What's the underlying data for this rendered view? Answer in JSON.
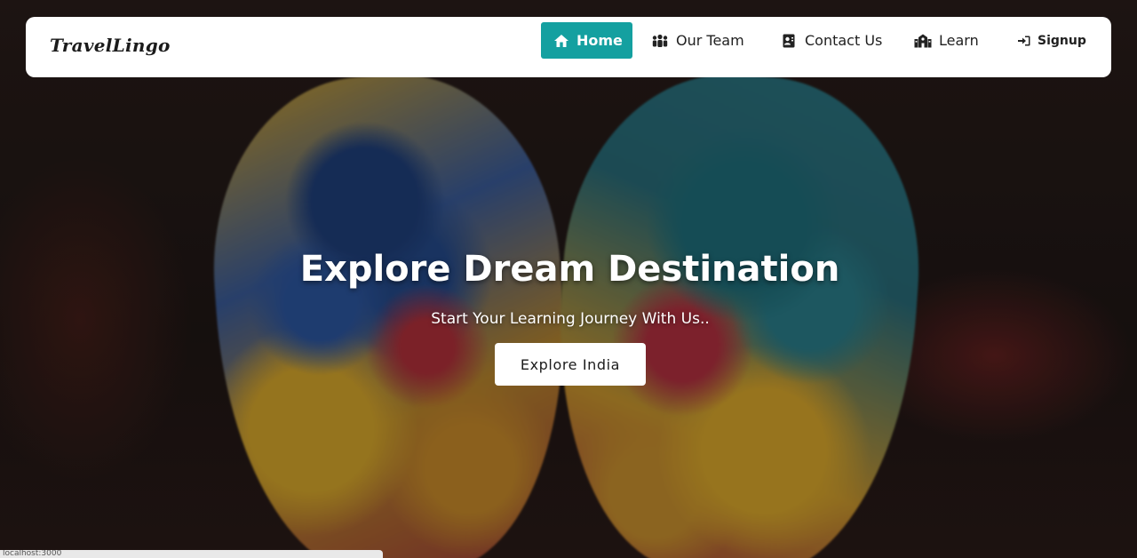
{
  "brand": {
    "name": "TravelLingo"
  },
  "nav": {
    "items": [
      {
        "label": "Home",
        "icon": "home-icon",
        "active": true
      },
      {
        "label": "Our Team",
        "icon": "team-icon",
        "active": false
      },
      {
        "label": "Contact Us",
        "icon": "contact-card-icon",
        "active": false
      },
      {
        "label": "Learn",
        "icon": "school-icon",
        "active": false
      }
    ],
    "signup": {
      "label": "Signup",
      "icon": "sign-in-icon"
    }
  },
  "hero": {
    "title": "Explore Dream Destination",
    "subtitle": "Start Your Learning Journey With Us..",
    "cta_label": "Explore India"
  },
  "status": {
    "text": "localhost:3000"
  },
  "colors": {
    "accent": "#14a0a0",
    "nav_bg": "#ffffff",
    "text_dark": "#1f1f1f"
  }
}
